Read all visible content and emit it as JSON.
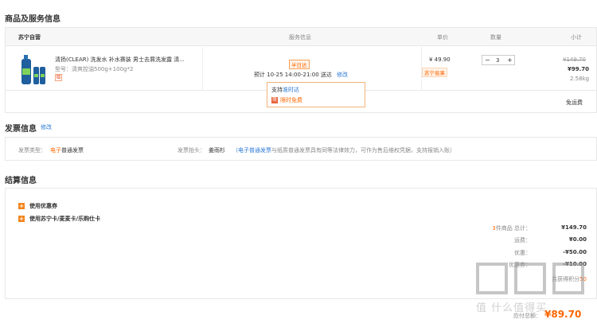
{
  "product_section": {
    "title": "商品及服务信息",
    "header": {
      "store": "苏宁自营",
      "service": "服务信息",
      "price": "单价",
      "qty": "数量",
      "subtotal": "小计"
    },
    "item": {
      "name": "清扬(CLEAR) 洗发水 补水赛装 男士去屑洗发露 清...",
      "model": "型号：清爽控油500g+100g*2",
      "badge": "赠",
      "same_day_tag": "半日达",
      "delivery": "预计 10-25 14:00-21:00 送达",
      "modify": "修改",
      "price": "¥ 49.90",
      "price_tag": "苏宁易果",
      "qty": "3",
      "minus": "−",
      "plus": "+",
      "orig_total": "¥149.70",
      "total": "¥99.70",
      "weight": "2.58kg"
    },
    "tooltip": {
      "line1_prefix": "支持",
      "line1_link": "准时达",
      "icon": "限",
      "line2": "限时免费"
    },
    "shipping": "免运费"
  },
  "invoice_section": {
    "title": "发票信息",
    "modify": "修改",
    "type_label": "发票类型：",
    "type_value_prefix": "电子",
    "type_value": "普通发票",
    "title_label": "发票抬头：",
    "title_value": "姜雨杉",
    "note_link": "（电子普通发票",
    "note": "与纸质普通发票具有同等法律效力，可作为售后维权凭据，支持报销入账）"
  },
  "settle_section": {
    "title": "结算信息",
    "options": [
      {
        "icon": "+",
        "label": "使用优惠券"
      },
      {
        "icon": "+",
        "label": "使用苏宁卡/麦麦卡/乐购仕卡"
      }
    ],
    "summary": [
      {
        "label_prefix": "3",
        "label": "件商品 总计：",
        "value": "¥149.70"
      },
      {
        "label_prefix": "",
        "label": "运费：",
        "value": "¥0.00"
      },
      {
        "label_prefix": "",
        "label": "优惠：",
        "value": "-¥50.00"
      },
      {
        "label_prefix": "",
        "label": "优惠券：",
        "value": "-¥10.00"
      }
    ],
    "points_text": "共获得积分",
    "points_value": "50",
    "total_label": "应付总额：",
    "total_value": "¥89.70"
  },
  "watermark": "值 什么值得买",
  "colors": {
    "accent": "#ff6600",
    "link": "#2b78d6",
    "border": "#e8e8e8"
  }
}
